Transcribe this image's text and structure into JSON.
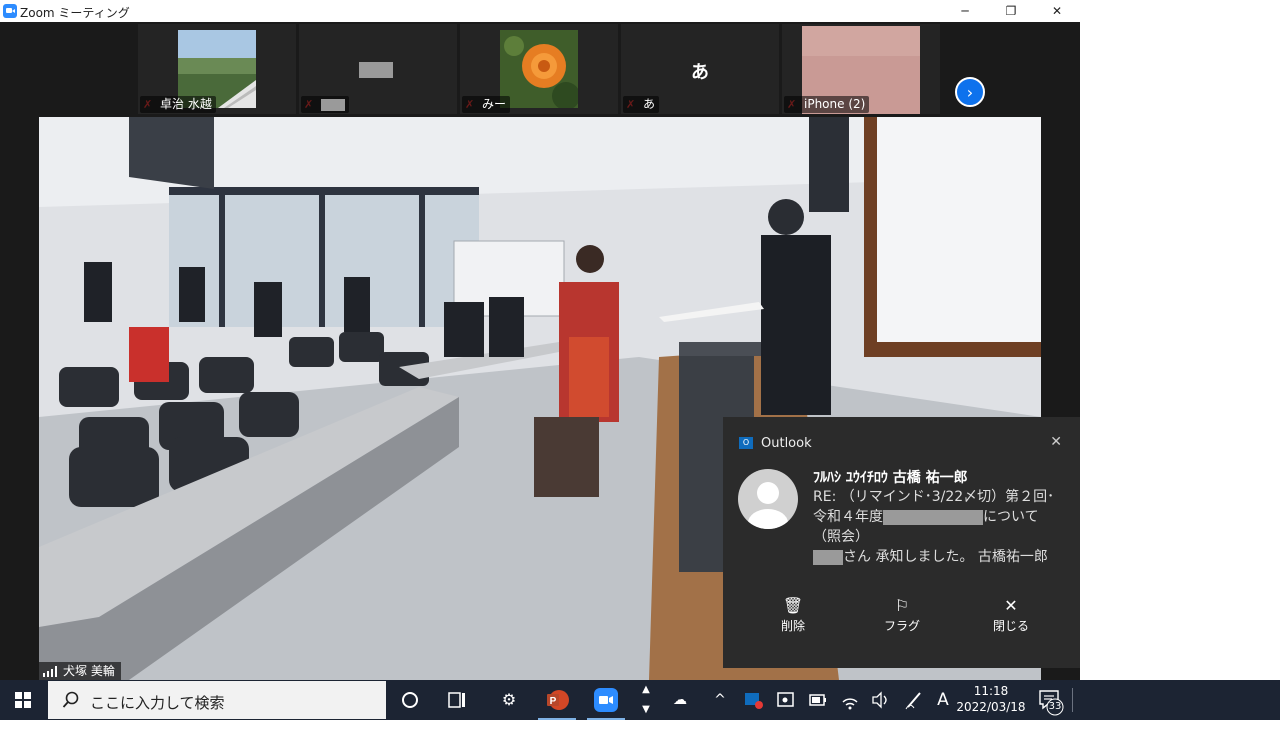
{
  "window": {
    "title": "Zoom ミーティング"
  },
  "window_controls": {
    "minimize": "─",
    "maximize": "❐",
    "close": "✕"
  },
  "participants": [
    {
      "name": "卓治 水越",
      "muted": true
    },
    {
      "name": "",
      "muted": true
    },
    {
      "name": "みー",
      "muted": true
    },
    {
      "name": "あ",
      "initial": "あ",
      "muted": true
    },
    {
      "name": "iPhone (2)",
      "muted": true
    }
  ],
  "active_speaker": {
    "name": "犬塚 美輪"
  },
  "notification": {
    "app": "Outlook",
    "sender": "ﾌﾙﾊｼ ﾕｳｲﾁﾛｳ 古橋 祐一郎",
    "subject_start": "RE: （リマインド･3/22〆切）第２回･令和４年度",
    "subject_end": "について（照会）",
    "preview_end": "さん 承知しました。 古橋祐一郎",
    "actions": {
      "delete": "削除",
      "flag": "フラグ",
      "close": "閉じる"
    }
  },
  "taskbar": {
    "search_placeholder": "ここに入力して検索",
    "ime": "A",
    "time": "11:18",
    "date": "2022/03/18",
    "notification_count": "33"
  },
  "colors": {
    "zoom_blue": "#2d8cff",
    "taskbar": "#1c2433",
    "toast_bg": "#2b2b2b"
  }
}
